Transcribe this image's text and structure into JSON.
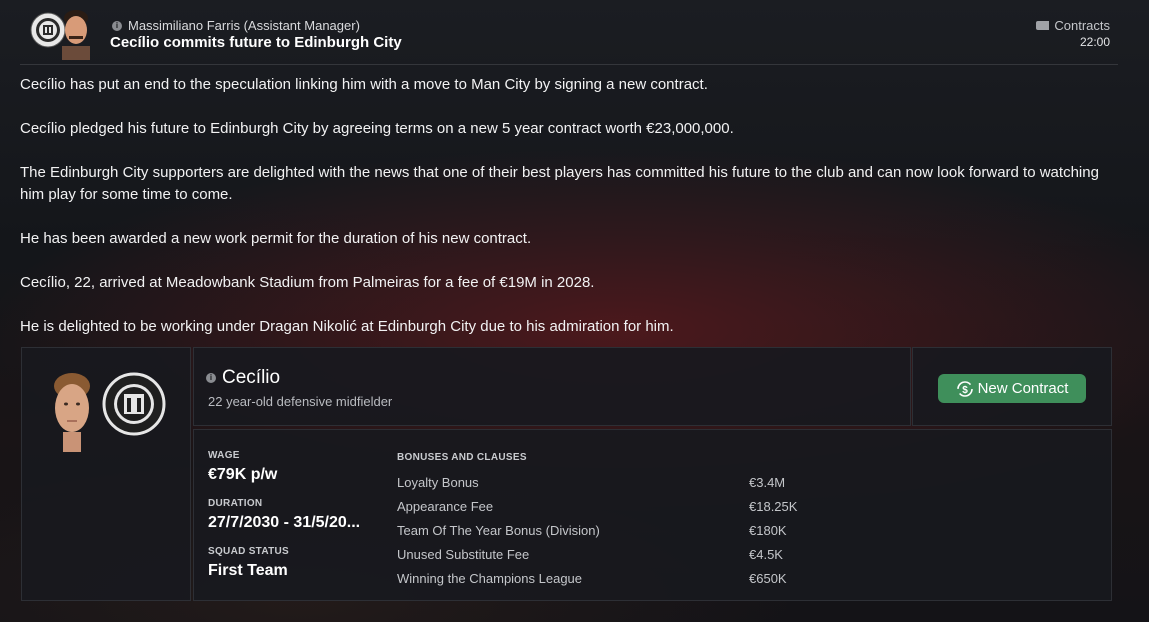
{
  "header": {
    "sender": "Massimiliano Farris (Assistant Manager)",
    "title": "Cecílio commits future to Edinburgh City",
    "category": "Contracts",
    "time": "22:00"
  },
  "body": {
    "paragraphs": [
      "Cecílio has put an end to the speculation linking him with a move to Man City by signing a new contract.",
      "Cecílio pledged his future to Edinburgh City by agreeing terms on a new 5 year contract worth €23,000,000.",
      "The Edinburgh City supporters are delighted with the news that one of their best players has committed his future to the club and can now look forward to watching him play for some time to come.",
      "He has been awarded a new work permit for the duration of his new contract.",
      "Cecílio, 22, arrived at Meadowbank Stadium from Palmeiras for a fee of €19M in 2028.",
      "He is delighted to be working under Dragan Nikolić at Edinburgh City due to his admiration for him."
    ]
  },
  "player": {
    "name": "Cecílio",
    "description": "22 year-old defensive midfielder"
  },
  "action": {
    "new_contract_label": "New Contract"
  },
  "contract": {
    "wage_label": "WAGE",
    "wage": "€79K p/w",
    "duration_label": "DURATION",
    "duration": "27/7/2030 - 31/5/20...",
    "squad_status_label": "SQUAD STATUS",
    "squad_status": "First Team",
    "bonuses_label": "BONUSES AND CLAUSES",
    "bonuses": [
      {
        "name": "Loyalty Bonus",
        "value": "€3.4M"
      },
      {
        "name": "Appearance Fee",
        "value": "€18.25K"
      },
      {
        "name": "Team Of The Year Bonus (Division)",
        "value": "€180K"
      },
      {
        "name": "Unused Substitute Fee",
        "value": "€4.5K"
      },
      {
        "name": "Winning the Champions League",
        "value": "€650K"
      }
    ]
  },
  "colors": {
    "accent_green": "#3f8f5b",
    "panel": "#18191e"
  }
}
